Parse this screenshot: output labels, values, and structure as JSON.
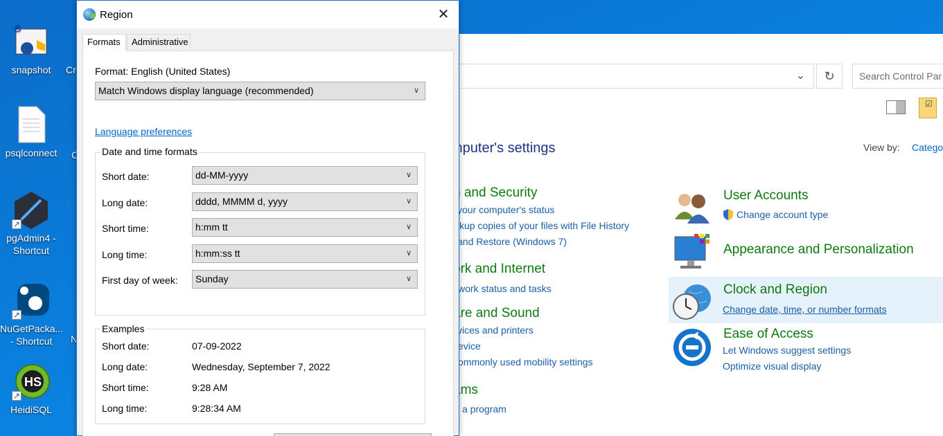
{
  "desktop": {
    "icons": [
      {
        "label": "snapshot"
      },
      {
        "label": "psqlconnect"
      },
      {
        "label": "pgAdmin4 - Shortcut"
      },
      {
        "label": "NuGetPacka... - Shortcut"
      },
      {
        "label": "HeidiSQL"
      }
    ],
    "partial_labels": [
      "Cr",
      "C",
      "N"
    ]
  },
  "control_panel": {
    "search_placeholder": "Search Control Par",
    "heading": "mputer's settings",
    "view_by_label": "View by:",
    "view_by_value": "Catego",
    "left_categories": [
      {
        "title": "n and Security",
        "links": [
          "your computer's status",
          "ckup copies of your files with File History",
          "and Restore (Windows 7)"
        ]
      },
      {
        "title": "ork and Internet",
        "links": [
          "work status and tasks"
        ]
      },
      {
        "title": "are and Sound",
        "links": [
          "vices and printers",
          "evice",
          "ommonly used mobility settings"
        ]
      },
      {
        "title": "ams",
        "links": [
          "a program"
        ]
      }
    ],
    "right_categories": [
      {
        "title": "User Accounts",
        "links": [
          "Change account type"
        ]
      },
      {
        "title": "Appearance and Personalization",
        "links": []
      },
      {
        "title": "Clock and Region",
        "links": [
          "Change date, time, or number formats"
        ]
      },
      {
        "title": "Ease of Access",
        "links": [
          "Let Windows suggest settings",
          "Optimize visual display"
        ]
      }
    ]
  },
  "dialog": {
    "title": "Region",
    "tabs": [
      "Formats",
      "Administrative"
    ],
    "format_label": "Format: English (United States)",
    "format_value": "Match Windows display language (recommended)",
    "language_link": "Language preferences",
    "date_time_group": "Date and time formats",
    "fields": [
      {
        "label": "Short date:",
        "value": "dd-MM-yyyy"
      },
      {
        "label": "Long date:",
        "value": "dddd, MMMM d, yyyy"
      },
      {
        "label": "Short time:",
        "value": "h:mm tt"
      },
      {
        "label": "Long time:",
        "value": "h:mm:ss tt"
      },
      {
        "label": "First day of week:",
        "value": "Sunday"
      }
    ],
    "examples_group": "Examples",
    "examples": [
      {
        "label": "Short date:",
        "value": "07-09-2022"
      },
      {
        "label": "Long date:",
        "value": "Wednesday, September 7, 2022"
      },
      {
        "label": "Short time:",
        "value": "9:28 AM"
      },
      {
        "label": "Long time:",
        "value": "9:28:34 AM"
      }
    ]
  }
}
